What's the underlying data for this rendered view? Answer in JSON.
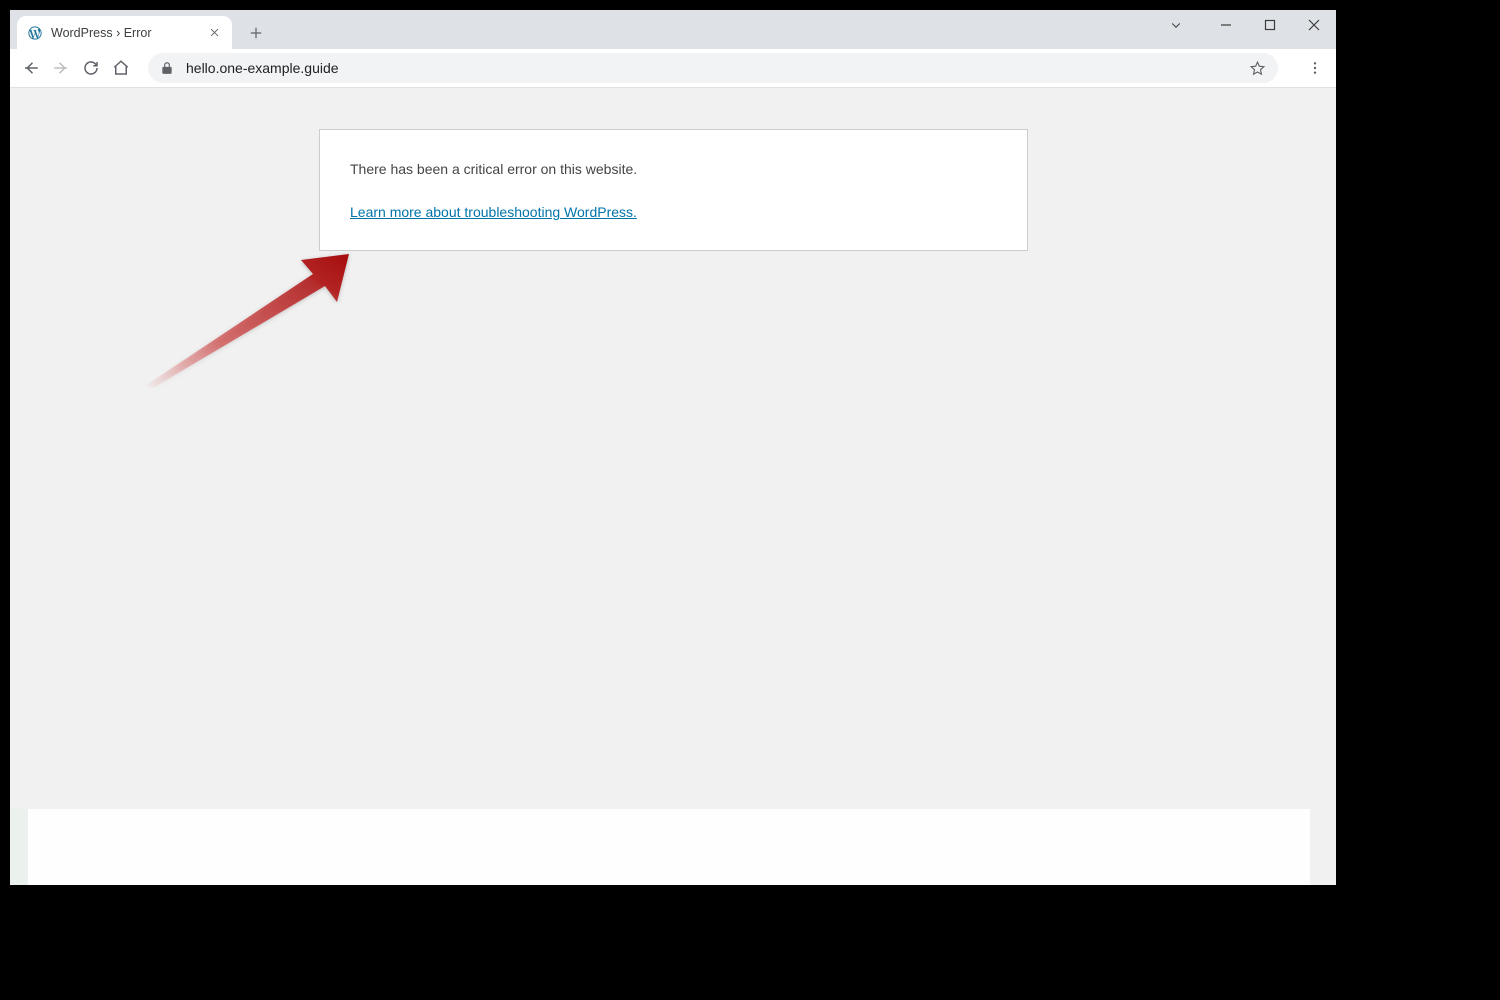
{
  "window": {
    "tab_title": "WordPress › Error",
    "url": "hello.one-example.guide"
  },
  "content": {
    "error_message": "There has been a critical error on this website.",
    "troubleshoot_link": "Learn more about troubleshooting WordPress."
  }
}
